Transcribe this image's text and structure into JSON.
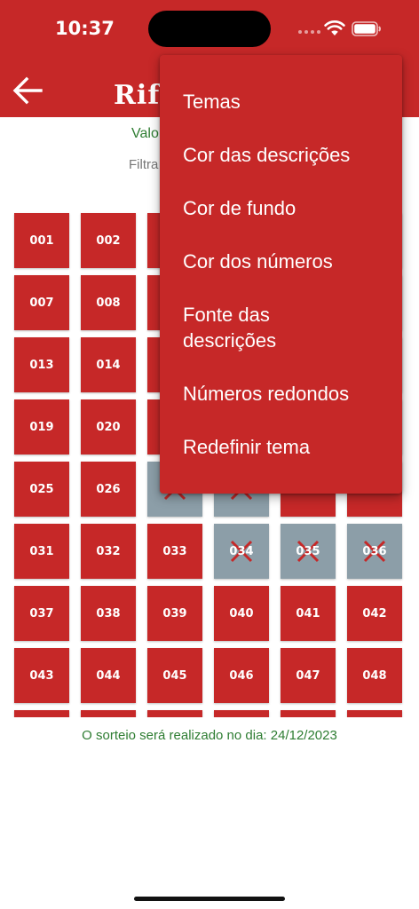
{
  "status_bar": {
    "time": "10:37"
  },
  "app_bar": {
    "title": "Rif",
    "back_icon": "arrow-left-icon"
  },
  "info": {
    "valor_label": "Valo",
    "filter_label": "Filtra"
  },
  "grid": {
    "rows": [
      [
        {
          "n": "001"
        },
        {
          "n": "002"
        },
        {
          "n": ""
        },
        {
          "n": ""
        },
        {
          "n": ""
        },
        {
          "n": ""
        }
      ],
      [
        {
          "n": "007"
        },
        {
          "n": "008"
        },
        {
          "n": ""
        },
        {
          "n": ""
        },
        {
          "n": ""
        },
        {
          "n": ""
        }
      ],
      [
        {
          "n": "013"
        },
        {
          "n": "014"
        },
        {
          "n": ""
        },
        {
          "n": ""
        },
        {
          "n": ""
        },
        {
          "n": ""
        }
      ],
      [
        {
          "n": "019"
        },
        {
          "n": "020"
        },
        {
          "n": ""
        },
        {
          "n": ""
        },
        {
          "n": ""
        },
        {
          "n": ""
        }
      ],
      [
        {
          "n": "025"
        },
        {
          "n": "026"
        },
        {
          "n": "",
          "sold": true
        },
        {
          "n": "",
          "sold": true
        },
        {
          "n": ""
        },
        {
          "n": ""
        }
      ],
      [
        {
          "n": "031"
        },
        {
          "n": "032"
        },
        {
          "n": "033"
        },
        {
          "n": "034",
          "sold": true
        },
        {
          "n": "035",
          "sold": true
        },
        {
          "n": "036",
          "sold": true
        }
      ],
      [
        {
          "n": "037"
        },
        {
          "n": "038"
        },
        {
          "n": "039"
        },
        {
          "n": "040"
        },
        {
          "n": "041"
        },
        {
          "n": "042"
        }
      ],
      [
        {
          "n": "043"
        },
        {
          "n": "044"
        },
        {
          "n": "045"
        },
        {
          "n": "046"
        },
        {
          "n": "047"
        },
        {
          "n": "048"
        }
      ],
      [
        {
          "n": ""
        },
        {
          "n": ""
        },
        {
          "n": ""
        },
        {
          "n": ""
        },
        {
          "n": ""
        },
        {
          "n": ""
        }
      ]
    ]
  },
  "footer": {
    "draw_date_text": "O sorteio será realizado no dia: 24/12/2023"
  },
  "menu": {
    "items": [
      {
        "label": "Temas"
      },
      {
        "label": "Cor das descrições"
      },
      {
        "label": "Cor de fundo"
      },
      {
        "label": "Cor dos números"
      },
      {
        "label": "Fonte das descrições"
      },
      {
        "label": "Números redondos"
      },
      {
        "label": "Redefinir tema"
      }
    ]
  },
  "colors": {
    "primary": "#c62828",
    "sold": "#8c9ea8",
    "accent_text": "#2e7d32"
  }
}
